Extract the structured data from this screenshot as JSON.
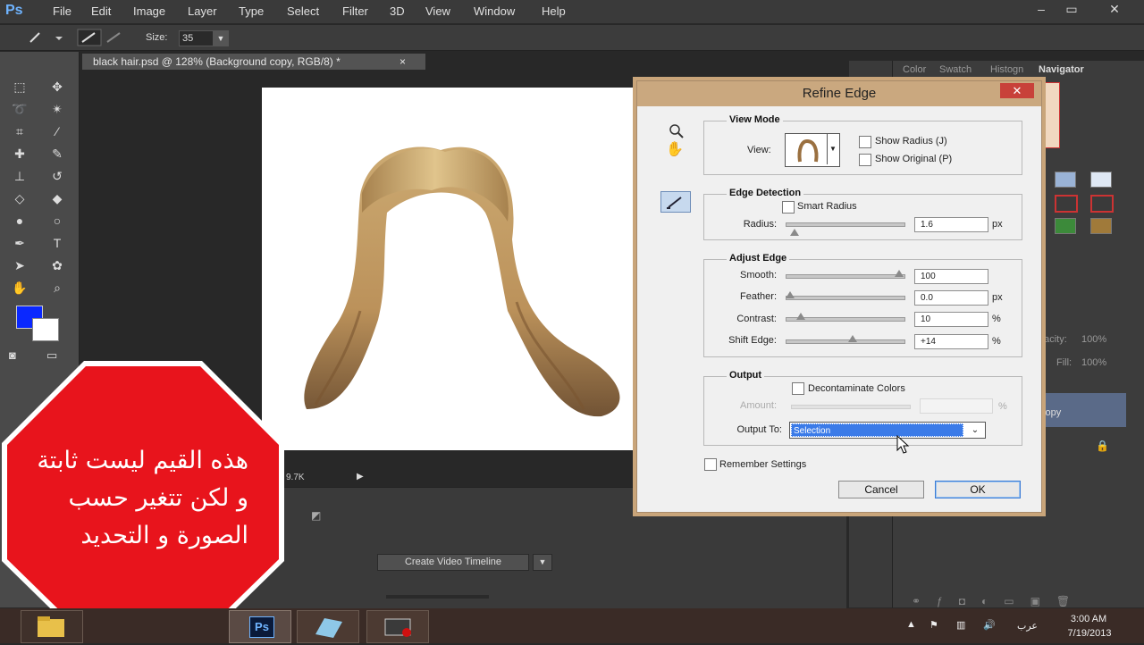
{
  "app": {
    "logo": "Ps"
  },
  "menu": [
    "File",
    "Edit",
    "Image",
    "Layer",
    "Type",
    "Select",
    "Filter",
    "3D",
    "View",
    "Window",
    "Help"
  ],
  "window_controls": [
    "–",
    "▭",
    "✕"
  ],
  "options_bar": {
    "size_label": "Size:",
    "size_value": "35"
  },
  "document": {
    "tab_title": "black hair.psd @ 128% (Background copy, RGB/8) *",
    "tab_close": "×",
    "status_text": "9.7K"
  },
  "timeline": {
    "create_button": "Create Video Timeline"
  },
  "panels": {
    "tabs": [
      "Color",
      "Swatch",
      "Histogn",
      "Navigator"
    ],
    "layers_opacity_label": "pacity:",
    "layers_opacity_value": "100%",
    "layers_fill_label": "Fill:",
    "layers_fill_value": "100%",
    "layer_name": "copy"
  },
  "colors": {
    "foreground": "#0a28ff",
    "background": "#ffffff",
    "stop_sign": "#e8141c",
    "dialog_title_bar": "#caa87f",
    "selected_dropdown": "#3b7be8"
  },
  "dialog": {
    "title": "Refine Edge",
    "close": "✕",
    "view_mode": {
      "title": "View Mode",
      "view_label": "View:",
      "show_radius": "Show Radius (J)",
      "show_original": "Show Original (P)"
    },
    "edge_detection": {
      "title": "Edge Detection",
      "smart_radius": "Smart Radius",
      "radius_label": "Radius:",
      "radius_value": "1.6",
      "radius_unit": "px",
      "radius_level": 0.04
    },
    "adjust_edge": {
      "title": "Adjust Edge",
      "rows": [
        {
          "label": "Smooth:",
          "value": "100",
          "unit": "",
          "level": 1.0
        },
        {
          "label": "Feather:",
          "value": "0.0",
          "unit": "px",
          "level": 0.0
        },
        {
          "label": "Contrast:",
          "value": "10",
          "unit": "%",
          "level": 0.1
        },
        {
          "label": "Shift Edge:",
          "value": "+14",
          "unit": "%",
          "level": 0.57
        }
      ]
    },
    "output": {
      "title": "Output",
      "decontaminate": "Decontaminate Colors",
      "amount_label": "Amount:",
      "amount_unit": "%",
      "output_to_label": "Output To:",
      "output_to_value": "Selection"
    },
    "remember": "Remember Settings",
    "cancel": "Cancel",
    "ok": "OK"
  },
  "overlay": {
    "line1": "هذه القيم ليست ثابتة",
    "line2": "و لكن تتغير حسب",
    "line3": "الصورة و التحديد"
  },
  "taskbar": {
    "ps_label": "Ps",
    "lang": "عرب",
    "time": "3:00 AM",
    "date": "7/19/2013"
  }
}
